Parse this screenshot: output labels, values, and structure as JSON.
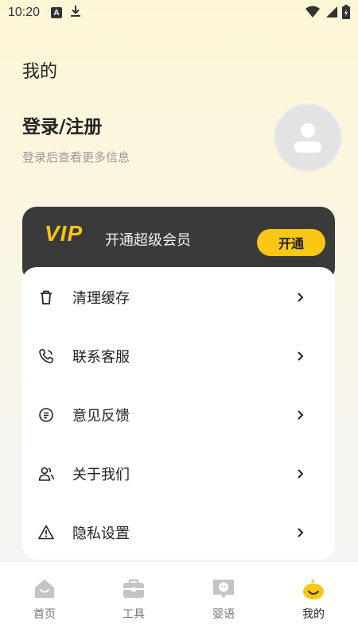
{
  "status_bar": {
    "time": "10:20",
    "left_icons": [
      "a-notification-icon",
      "download-icon"
    ],
    "right_icons": [
      "wifi-icon",
      "signal-icon",
      "battery-charging-icon"
    ]
  },
  "header": {
    "title": "我的"
  },
  "profile": {
    "login_title": "登录/注册",
    "login_subtitle": "登录后查看更多信息",
    "avatar_icon": "user-avatar-icon"
  },
  "vip": {
    "logo": "VIP",
    "text": "开通超级会员",
    "button_label": "开通",
    "accent_color": "#f9c716"
  },
  "menu": {
    "items": [
      {
        "label": "清理缓存",
        "icon": "trash-icon"
      },
      {
        "label": "联系客服",
        "icon": "phone-icon"
      },
      {
        "label": "意见反馈",
        "icon": "feedback-icon"
      },
      {
        "label": "关于我们",
        "icon": "users-icon"
      },
      {
        "label": "隐私设置",
        "icon": "warning-icon"
      }
    ]
  },
  "tab_bar": {
    "tabs": [
      {
        "label": "首页",
        "icon": "home-icon",
        "active": false
      },
      {
        "label": "工具",
        "icon": "toolbox-icon",
        "active": false
      },
      {
        "label": "婴语",
        "icon": "baby-chat-icon",
        "active": false
      },
      {
        "label": "我的",
        "icon": "profile-face-icon",
        "active": true
      }
    ]
  }
}
